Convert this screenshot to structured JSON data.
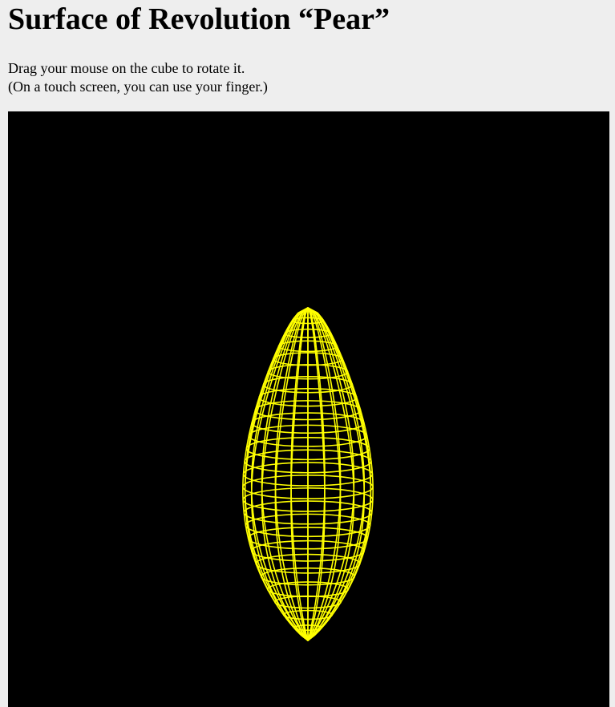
{
  "page": {
    "title": "Surface of Revolution “Pear”",
    "instructions": [
      "Drag your mouse on the cube to rotate it.",
      "(On a touch screen, you can use your finger.)"
    ]
  },
  "viewport": {
    "background_color": "#000000",
    "wireframe_color": "#ffff00",
    "shape": "pear"
  }
}
